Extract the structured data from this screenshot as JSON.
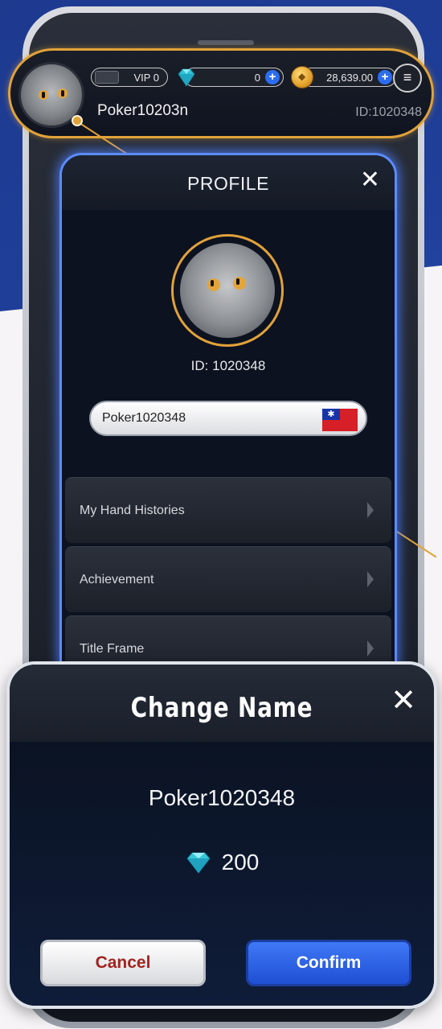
{
  "top_bar": {
    "vip_label": "VIP 0",
    "diamond_balance": "0",
    "coin_balance": "28,639.00",
    "username": "Poker10203n",
    "user_id": "ID:1020348"
  },
  "profile": {
    "title": "PROFILE",
    "close_symbol": "✕",
    "id_label": "ID: 1020348",
    "name_value": "Poker1020348",
    "flag_symbol": "✱",
    "menu_items": [
      {
        "label": "My Hand Histories"
      },
      {
        "label": "Achievement"
      },
      {
        "label": "Title Frame"
      }
    ]
  },
  "dialog": {
    "title": "Change Name",
    "close_symbol": "✕",
    "new_name": "Poker1020348",
    "cost": "200",
    "cancel_label": "Cancel",
    "confirm_label": "Confirm"
  },
  "colors": {
    "accent_gold": "#e1a23a",
    "glow_blue": "#5b8cff",
    "confirm_blue": "#2c63e8",
    "cancel_text": "#a3231f"
  },
  "icons": [
    "menu-icon",
    "diamond-icon",
    "coin-icon",
    "plus-icon",
    "close-icon",
    "chevron-right-icon",
    "flag-icon"
  ]
}
